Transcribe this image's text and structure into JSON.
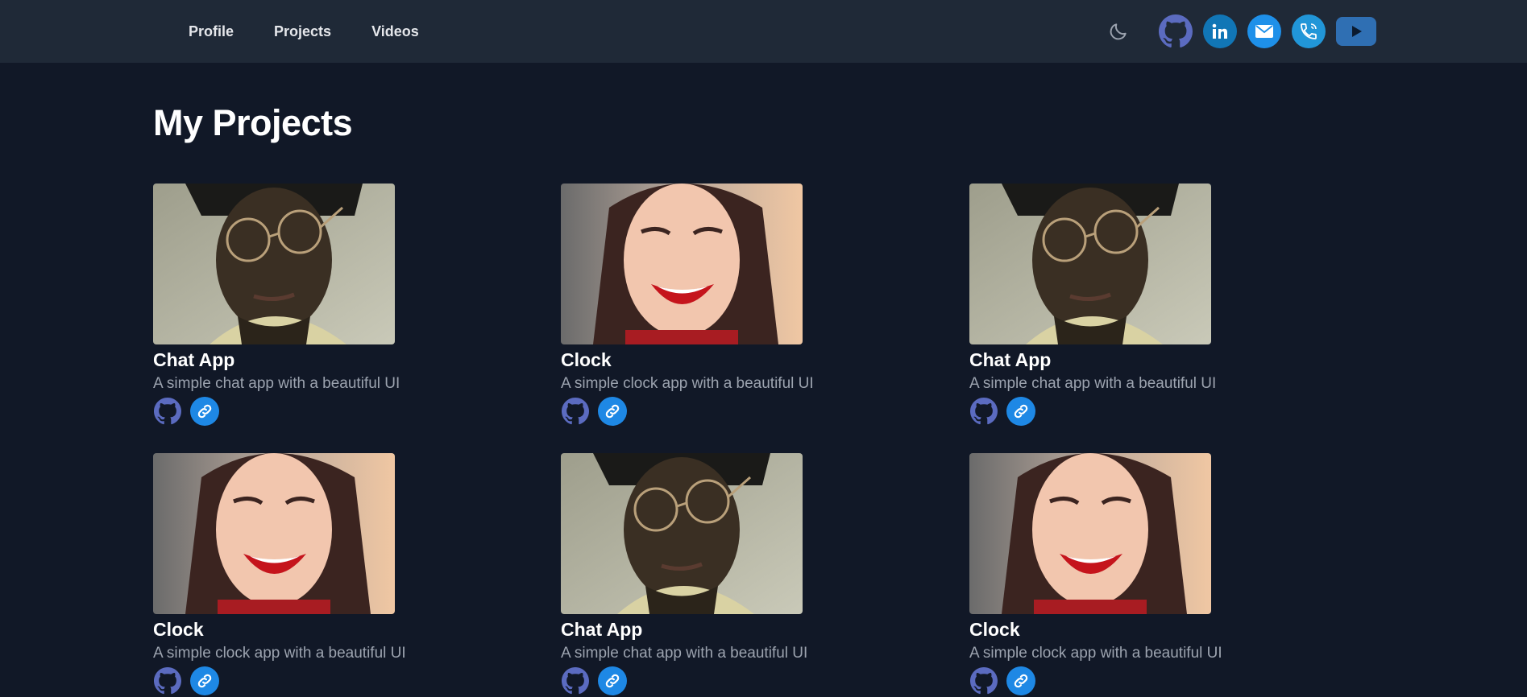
{
  "nav": {
    "links": [
      "Profile",
      "Projects",
      "Videos"
    ]
  },
  "socials": [
    {
      "name": "github-icon",
      "color": "#5b6bc0"
    },
    {
      "name": "linkedin-icon",
      "color": "#1176b6"
    },
    {
      "name": "mail-icon",
      "color": "#1e90e9"
    },
    {
      "name": "phone-icon",
      "color": "#2196d8"
    },
    {
      "name": "youtube-icon",
      "color": "#2f6fb3"
    }
  ],
  "main": {
    "title": "My Projects",
    "projects": [
      {
        "title": "Chat App",
        "description": "A simple chat app with a beautiful UI",
        "image": "man-with-glasses"
      },
      {
        "title": "Clock",
        "description": "A simple clock app with a beautiful UI",
        "image": "smiling-woman"
      },
      {
        "title": "Chat App",
        "description": "A simple chat app with a beautiful UI",
        "image": "man-with-glasses"
      },
      {
        "title": "Clock",
        "description": "A simple clock app with a beautiful UI",
        "image": "smiling-woman"
      },
      {
        "title": "Chat App",
        "description": "A simple chat app with a beautiful UI",
        "image": "man-with-glasses"
      },
      {
        "title": "Clock",
        "description": "A simple clock app with a beautiful UI",
        "image": "smiling-woman"
      }
    ]
  },
  "colors": {
    "background": "#111827",
    "navbar": "#1f2937",
    "accent": "#1e88e5",
    "github": "#5b6bc0",
    "muted_text": "#9ca3af"
  }
}
